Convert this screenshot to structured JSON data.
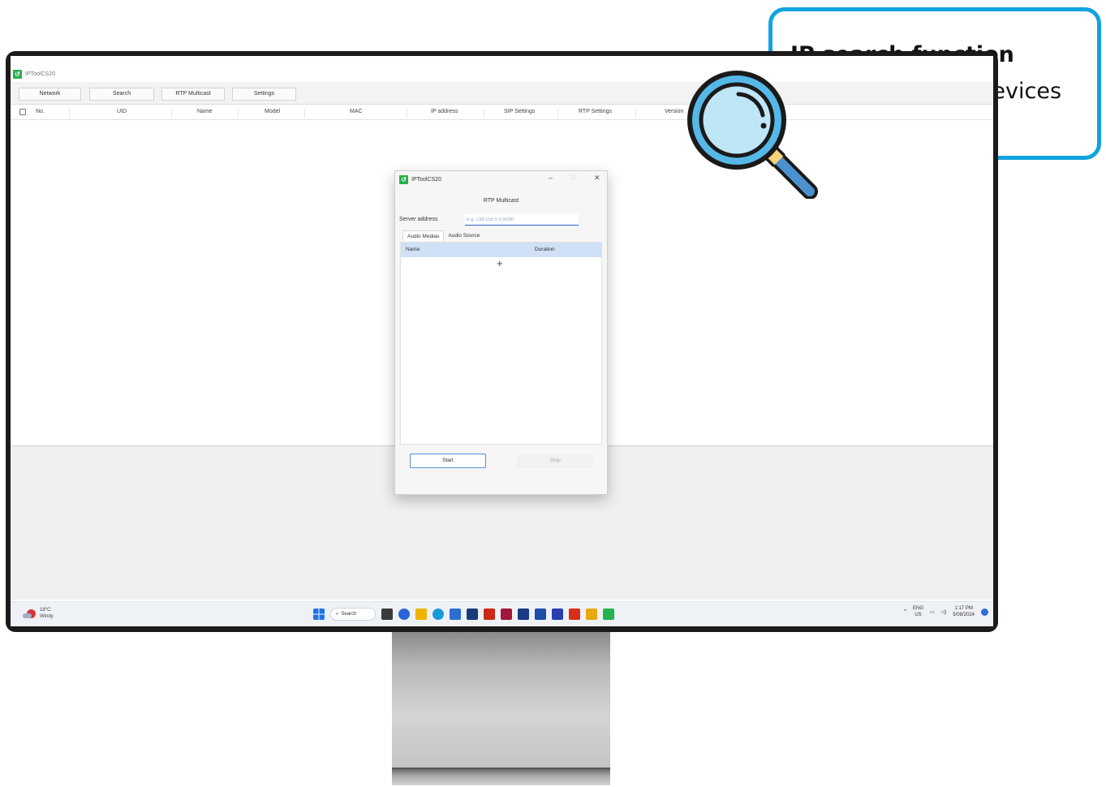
{
  "app": {
    "window_title": "IPToolCS20",
    "toolbar": [
      "Network",
      "Search",
      "RTP Multicast",
      "Settings"
    ],
    "columns": [
      "No.",
      "UID",
      "Name",
      "Model",
      "MAC",
      "IP address",
      "SIP Settings",
      "RTP Settings",
      "Version"
    ]
  },
  "dialog": {
    "title": "IPToolCS20",
    "minimize": "–",
    "maximize": "□",
    "close": "✕",
    "heading": "RTP Multicast",
    "server_label": "Server address",
    "server_placeholder": "e.g. 239.255.0.0:6000",
    "tabs": [
      "Audio Medias",
      "Audio Source"
    ],
    "table_columns": [
      "Name",
      "Duration"
    ],
    "add_symbol": "+",
    "start": "Start",
    "stop": "Stop"
  },
  "taskbar": {
    "temp": "18°C",
    "weather": "Windy",
    "search": "Search",
    "lang_top": "ENG",
    "lang_bottom": "US",
    "time": "1:17 PM",
    "date": "5/08/2024",
    "app_icon_colors": [
      "#3a3a3a",
      "#2b64d9",
      "#f0b400",
      "#1b9bd8",
      "#2c6fd1",
      "#173c7a",
      "#cc2a17",
      "#a0173a",
      "#1a3a82",
      "#1f4ea8",
      "#2a3eb0",
      "#d92e1b",
      "#e8a80f",
      "#25b24a"
    ]
  },
  "callout": {
    "title": "IP search function",
    "body": "Connecting your devices easily."
  }
}
